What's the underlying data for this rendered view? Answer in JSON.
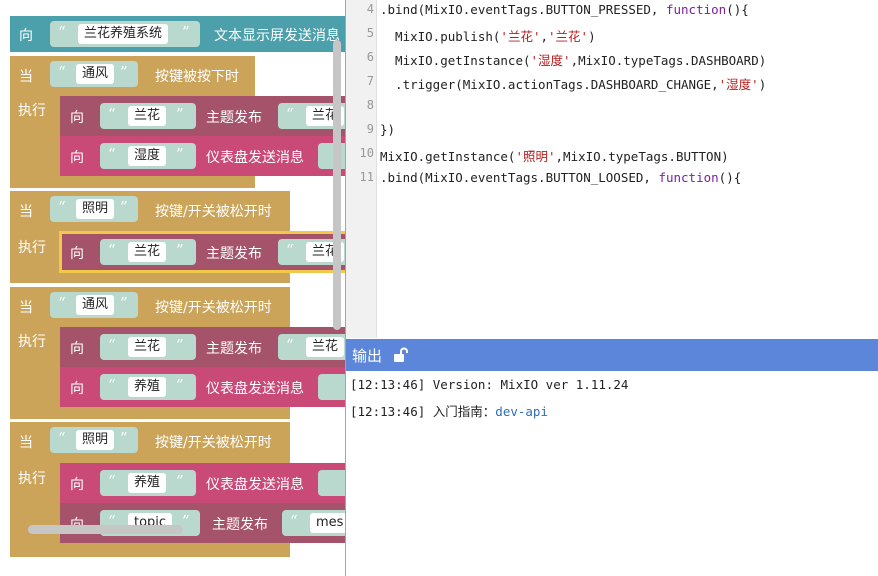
{
  "workspace": {
    "header_block": {
      "kw": "向",
      "tag": "兰花养殖系统",
      "action": "文本显示屏发送消息"
    },
    "labels": {
      "when": "当",
      "exec": "执行",
      "to": "向",
      "quote": "“",
      "unquote": "”"
    },
    "events": [
      {
        "tag": "通风",
        "action": "按键被按下时",
        "rows": [
          {
            "tag": "兰花",
            "action": "主题发布",
            "tag2": "兰花"
          },
          {
            "tag": "湿度",
            "action": "仪表盘发送消息",
            "tag2": ""
          }
        ]
      },
      {
        "tag": "照明",
        "action": "按键/开关被松开时",
        "rows": [
          {
            "tag": "兰花",
            "action": "主题发布",
            "tag2": "兰花"
          }
        ]
      },
      {
        "tag": "通风",
        "action": "按键/开关被松开时",
        "rows": [
          {
            "tag": "兰花",
            "action": "主题发布",
            "tag2": "兰花"
          },
          {
            "tag": "养殖",
            "action": "仪表盘发送消息",
            "tag2": ""
          }
        ]
      },
      {
        "tag": "照明",
        "action": "按键/开关被松开时",
        "rows": [
          {
            "tag": "养殖",
            "action": "仪表盘发送消息",
            "tag2": ""
          },
          {
            "tag": "topic",
            "action": "主题发布",
            "tag2": "mes"
          }
        ]
      }
    ]
  },
  "editor": {
    "lines": [
      {
        "n": "4",
        "parts": [
          [
            ".bind(MixIO.eventTags.BUTTON_PRESSED, ",
            ""
          ],
          [
            "function",
            "fn"
          ],
          [
            "(){",
            ""
          ]
        ]
      },
      {
        "n": "5",
        "parts": [
          [
            "  MixIO.publish(",
            ""
          ],
          [
            "'兰花'",
            "str"
          ],
          [
            ",",
            ""
          ],
          [
            "'兰花'",
            "str"
          ],
          [
            ")",
            ""
          ]
        ]
      },
      {
        "n": "6",
        "parts": [
          [
            "  MixIO.getInstance(",
            ""
          ],
          [
            "'湿度'",
            "str"
          ],
          [
            ",MixIO.typeTags.DASHBOARD)",
            ""
          ]
        ]
      },
      {
        "n": "7",
        "parts": [
          [
            "  .trigger(MixIO.actionTags.DASHBOARD_CHANGE,",
            ""
          ],
          [
            "'湿度'",
            "str"
          ],
          [
            ")",
            ""
          ]
        ]
      },
      {
        "n": "8",
        "parts": []
      },
      {
        "n": "9",
        "parts": [
          [
            "})",
            ""
          ]
        ]
      },
      {
        "n": "10",
        "parts": [
          [
            "MixIO.getInstance(",
            ""
          ],
          [
            "'照明'",
            "str"
          ],
          [
            ",MixIO.typeTags.BUTTON)",
            ""
          ]
        ]
      },
      {
        "n": "11",
        "parts": [
          [
            ".bind(MixIO.eventTags.BUTTON_LOOSED, ",
            ""
          ],
          [
            "function",
            "fn"
          ],
          [
            "(){",
            ""
          ]
        ]
      }
    ]
  },
  "output": {
    "title": "输出",
    "lock_icon": "unlock-icon",
    "logs": [
      {
        "time": "[12:13:46]",
        "text": " Version: MixIO ver 1.11.24",
        "link": ""
      },
      {
        "time": "[12:13:46]",
        "text": " 入门指南：",
        "link": "dev-api"
      }
    ]
  },
  "colors": {
    "teal": "#4ca0ac",
    "gold": "#cba45a",
    "mauve": "#a4536a",
    "pink": "#c94a77",
    "output_header": "#5b86d9"
  }
}
